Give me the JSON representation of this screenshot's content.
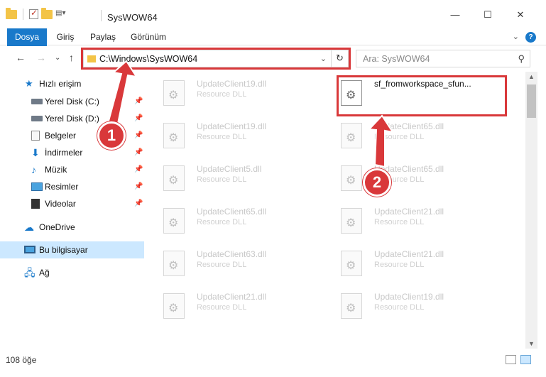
{
  "window": {
    "title": "SysWOW64",
    "minimize": "—",
    "maximize": "☐",
    "close": "✕"
  },
  "ribbon": {
    "tabs": [
      "Dosya",
      "Giriş",
      "Paylaş",
      "Görünüm"
    ],
    "help": "?",
    "collapse": "⌄"
  },
  "nav": {
    "back": "←",
    "forward": "→",
    "recent": "⌄",
    "up": "↑"
  },
  "address": {
    "path": "C:\\Windows\\SysWOW64",
    "dropdown": "⌄",
    "refresh": "↻"
  },
  "search": {
    "placeholder": "Ara: SysWOW64",
    "icon": "search-icon"
  },
  "sidebar": {
    "quick_access": "Hızlı erişim",
    "items": [
      {
        "label": "Yerel Disk (C:)",
        "icon": "drive-icon",
        "pinned": true
      },
      {
        "label": "Yerel Disk (D:)",
        "icon": "drive-icon",
        "pinned": true
      },
      {
        "label": "Belgeler",
        "icon": "documents-icon",
        "pinned": true
      },
      {
        "label": "İndirmeler",
        "icon": "download-icon",
        "pinned": true
      },
      {
        "label": "Müzik",
        "icon": "music-icon",
        "pinned": true
      },
      {
        "label": "Resimler",
        "icon": "pictures-icon",
        "pinned": true
      },
      {
        "label": "Videolar",
        "icon": "videos-icon",
        "pinned": true
      }
    ],
    "onedrive": "OneDrive",
    "this_pc": "Bu bilgisayar",
    "network": "Ağ"
  },
  "files": {
    "left": [
      {
        "name": "UpdateClient19.dll",
        "type": "Resource DLL"
      },
      {
        "name": "UpdateClient19.dll",
        "type": "Resource DLL"
      },
      {
        "name": "UpdateClient5.dll",
        "type": "Resource DLL"
      },
      {
        "name": "UpdateClient65.dll",
        "type": "Resource DLL"
      },
      {
        "name": "UpdateClient63.dll",
        "type": "Resource DLL"
      },
      {
        "name": "UpdateClient21.dll",
        "type": "Resource DLL"
      }
    ],
    "right": [
      {
        "name": "sf_fromworkspace_sfun...",
        "type": ""
      },
      {
        "name": "UpdateClient65.dll",
        "type": "Resource DLL"
      },
      {
        "name": "UpdateClient65.dll",
        "type": "Resource DLL"
      },
      {
        "name": "UpdateClient21.dll",
        "type": "Resource DLL"
      },
      {
        "name": "UpdateClient21.dll",
        "type": "Resource DLL"
      },
      {
        "name": "UpdateClient19.dll",
        "type": "Resource DLL"
      }
    ]
  },
  "status": {
    "count": "108 öğe"
  },
  "markers": {
    "step1": "1",
    "step2": "2"
  },
  "colors": {
    "accent": "#1979ca",
    "highlight": "#d9383a",
    "selected": "#cce8ff"
  }
}
